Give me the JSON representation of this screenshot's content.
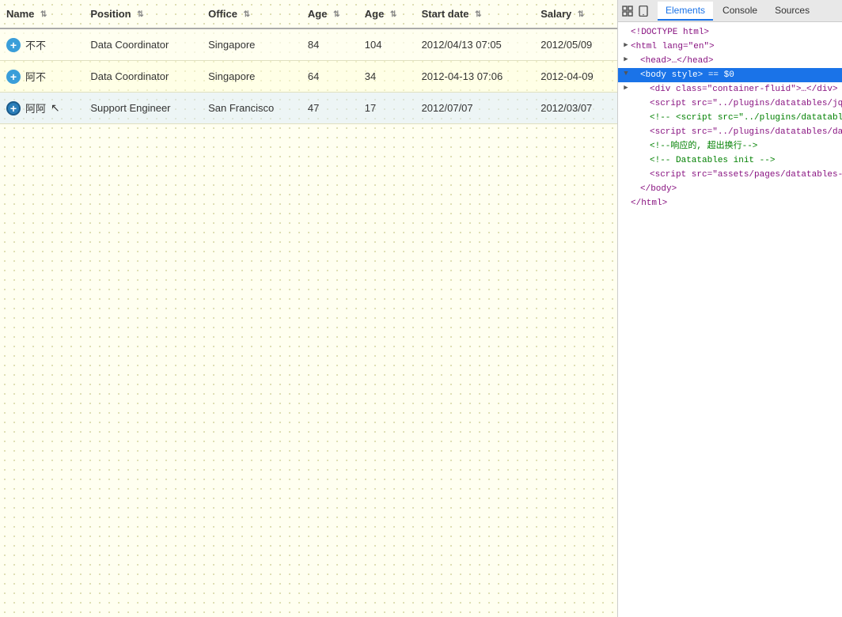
{
  "table": {
    "columns": [
      {
        "label": "Name",
        "key": "name",
        "sortable": true
      },
      {
        "label": "Position",
        "key": "position",
        "sortable": true
      },
      {
        "label": "Office",
        "key": "office",
        "sortable": true
      },
      {
        "label": "Age",
        "key": "age1",
        "sortable": true
      },
      {
        "label": "Age",
        "key": "age2",
        "sortable": true
      },
      {
        "label": "Start date",
        "key": "start_date",
        "sortable": true
      },
      {
        "label": "Salary",
        "key": "salary",
        "sortable": true
      }
    ],
    "rows": [
      {
        "id": 1,
        "name": "不不",
        "position": "Data Coordinator",
        "office": "Singapore",
        "age1": "84",
        "age2": "104",
        "start_date": "2012/04/13 07:05",
        "salary": "2012/05/09",
        "expanded": false,
        "active": false
      },
      {
        "id": 2,
        "name": "阿不",
        "position": "Data Coordinator",
        "office": "Singapore",
        "age1": "64",
        "age2": "34",
        "start_date": "2012-04-13 07:06",
        "salary": "2012-04-09",
        "expanded": false,
        "active": false
      },
      {
        "id": 3,
        "name": "阿阿",
        "position": "Support Engineer",
        "office": "San Francisco",
        "age1": "47",
        "age2": "17",
        "start_date": "2012/07/07",
        "salary": "2012/03/07",
        "expanded": false,
        "active": true
      }
    ]
  },
  "devtools": {
    "tabs": [
      {
        "label": "Elements",
        "active": true
      },
      {
        "label": "Console",
        "active": false
      },
      {
        "label": "Sources",
        "active": false
      }
    ],
    "code_lines": [
      {
        "indent": 0,
        "arrow": "none",
        "content": "<!DOCTYPE html>",
        "type": "doctype"
      },
      {
        "indent": 0,
        "arrow": "collapsed",
        "content": "<html lang=\"en\">",
        "type": "tag"
      },
      {
        "indent": 1,
        "arrow": "collapsed",
        "content": "<head>…</head>",
        "type": "tag"
      },
      {
        "indent": 1,
        "arrow": "expanded",
        "content": "<body style> == $0",
        "type": "tag-highlighted"
      },
      {
        "indent": 2,
        "arrow": "collapsed",
        "content": "<div class=\"container-fluid\">…</div>",
        "type": "tag"
      },
      {
        "indent": 2,
        "arrow": "none",
        "content": "<script src=\"../plugins/datatables/jq",
        "type": "tag"
      },
      {
        "indent": 2,
        "arrow": "none",
        "content": "<!-- <script src=\"../plugins/datatabl",
        "type": "comment"
      },
      {
        "indent": 2,
        "arrow": "none",
        "content": "<script src=\"../plugins/datatables/da",
        "type": "tag"
      },
      {
        "indent": 2,
        "arrow": "none",
        "content": "<!--响应的, 超出换行-->",
        "type": "comment"
      },
      {
        "indent": 2,
        "arrow": "none",
        "content": "<!-- Datatables init -->",
        "type": "comment"
      },
      {
        "indent": 2,
        "arrow": "none",
        "content": "<script src=\"assets/pages/datatables-",
        "type": "tag"
      },
      {
        "indent": 1,
        "arrow": "none",
        "content": "</body>",
        "type": "tag"
      },
      {
        "indent": 0,
        "arrow": "none",
        "content": "</html>",
        "type": "tag"
      }
    ]
  }
}
